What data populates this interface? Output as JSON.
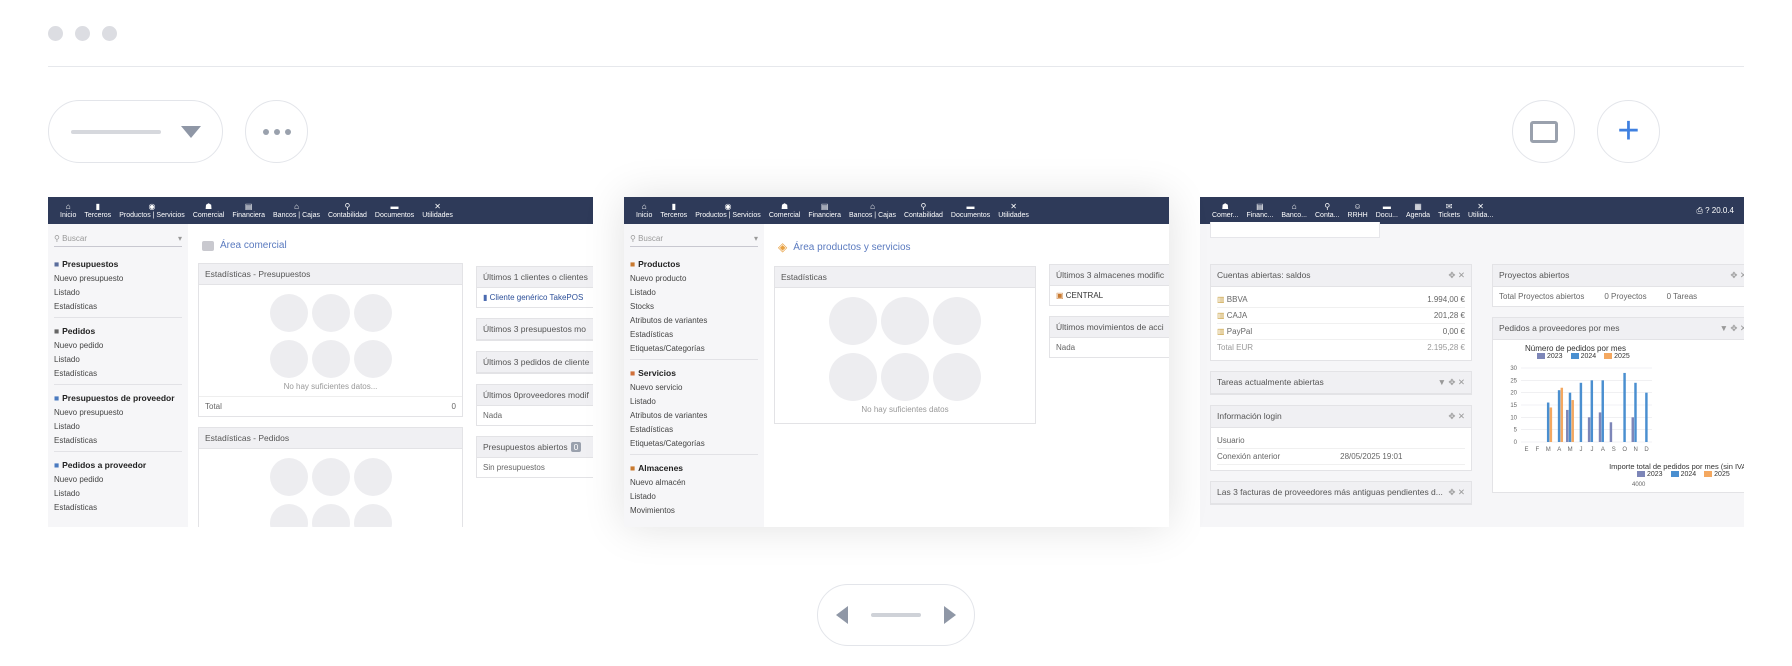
{
  "slide1": {
    "nav": [
      {
        "icon": "⌂",
        "label": "Inicio"
      },
      {
        "icon": "▮",
        "label": "Terceros"
      },
      {
        "icon": "◉",
        "label": "Productos | Servicios"
      },
      {
        "icon": "☗",
        "label": "Comercial"
      },
      {
        "icon": "▤",
        "label": "Financiera"
      },
      {
        "icon": "⌂",
        "label": "Bancos | Cajas"
      },
      {
        "icon": "⚲",
        "label": "Contabilidad"
      },
      {
        "icon": "▬",
        "label": "Documentos"
      },
      {
        "icon": "✕",
        "label": "Utilidades"
      }
    ],
    "search": "Buscar",
    "menu": [
      {
        "title": "Presupuestos",
        "items": [
          "Nuevo presupuesto",
          "Listado",
          "Estadísticas"
        ]
      },
      {
        "title": "Pedidos",
        "items": [
          "Nuevo pedido",
          "Listado",
          "Estadísticas"
        ]
      },
      {
        "title": "Presupuestos de proveedor",
        "items": [
          "Nuevo presupuesto",
          "Listado",
          "Estadísticas"
        ]
      },
      {
        "title": "Pedidos a proveedor",
        "items": [
          "Nuevo pedido",
          "Listado",
          "Estadísticas"
        ]
      }
    ],
    "area_title": "Área comercial",
    "box1_title": "Estadísticas - Presupuestos",
    "no_data": "No hay suficientes datos...",
    "total_label": "Total",
    "total_value": "0",
    "box2_title": "Estadísticas - Pedidos",
    "right_boxes": [
      {
        "title": "Últimos 1 clientes o clientes",
        "body": "Cliente genérico TakePOS"
      },
      {
        "title": "Últimos 3 presupuestos mo",
        "body": ""
      },
      {
        "title": "Últimos 3 pedidos de cliente",
        "body": ""
      },
      {
        "title": "Últimos 0proveedores modif",
        "body": "Nada"
      },
      {
        "title": "Presupuestos abiertos",
        "badge": "0",
        "body": "Sin presupuestos"
      }
    ]
  },
  "slide2": {
    "nav": [
      {
        "icon": "⌂",
        "label": "Inicio"
      },
      {
        "icon": "▮",
        "label": "Terceros"
      },
      {
        "icon": "◉",
        "label": "Productos | Servicios"
      },
      {
        "icon": "☗",
        "label": "Comercial"
      },
      {
        "icon": "▤",
        "label": "Financiera"
      },
      {
        "icon": "⌂",
        "label": "Bancos | Cajas"
      },
      {
        "icon": "⚲",
        "label": "Contabilidad"
      },
      {
        "icon": "▬",
        "label": "Documentos"
      },
      {
        "icon": "✕",
        "label": "Utilidades"
      }
    ],
    "search": "Buscar",
    "menu": [
      {
        "title": "Productos",
        "items": [
          "Nuevo producto",
          "Listado",
          "Stocks",
          "Atributos de variantes",
          "Estadísticas",
          "Etiquetas/Categorías"
        ]
      },
      {
        "title": "Servicios",
        "items": [
          "Nuevo servicio",
          "Listado",
          "Atributos de variantes",
          "Estadísticas",
          "Etiquetas/Categorías"
        ]
      },
      {
        "title": "Almacenes",
        "items": [
          "Nuevo almacén",
          "Listado",
          "Movimientos"
        ]
      }
    ],
    "area_title": "Área productos y servicios",
    "stats_title": "Estadísticas",
    "no_data": "No hay suficientes datos",
    "box_a_title": "Últimos 3 almacenes modific",
    "box_a_body": "CENTRAL",
    "box_b_title": "Últimos movimientos de acci",
    "box_b_body": "Nada"
  },
  "slide3": {
    "nav": [
      {
        "icon": "☗",
        "label": "Comer..."
      },
      {
        "icon": "▤",
        "label": "Financ..."
      },
      {
        "icon": "⌂",
        "label": "Banco..."
      },
      {
        "icon": "⚲",
        "label": "Conta..."
      },
      {
        "icon": "☺",
        "label": "RRHH"
      },
      {
        "icon": "▬",
        "label": "Docu..."
      },
      {
        "icon": "▦",
        "label": "Agenda"
      },
      {
        "icon": "✉",
        "label": "Tickets"
      },
      {
        "icon": "✕",
        "label": "Utilida..."
      }
    ],
    "version": "20.0.4",
    "accounts": {
      "title": "Cuentas abiertas: saldos",
      "rows": [
        {
          "name": "BBVA",
          "value": "1.994,00 €"
        },
        {
          "name": "CAJA",
          "value": "201,28 €"
        },
        {
          "name": "PayPal",
          "value": "0,00 €"
        }
      ],
      "total_label": "Total EUR",
      "total_value": "2.195,28 €"
    },
    "tasks_title": "Tareas actualmente abiertas",
    "login": {
      "title": "Información login",
      "user_label": "Usuario",
      "prev_label": "Conexión anterior",
      "prev_value": "28/05/2025 19:01"
    },
    "invoices_title": "Las 3 facturas de proveedores más antiguas pendientes d...",
    "projects": {
      "title": "Proyectos abiertos",
      "label": "Total Proyectos abiertos",
      "count": "0 Proyectos",
      "tasks": "0 Tareas"
    },
    "orders_title": "Pedidos a proveedores por mes",
    "chart2_title": "Importe total de pedidos por mes (sin IVA)",
    "chart2_ytick": "4000"
  },
  "chart_data": {
    "type": "bar",
    "title": "Número de pedidos por mes",
    "categories": [
      "E",
      "F",
      "M",
      "A",
      "M",
      "J",
      "J",
      "A",
      "S",
      "O",
      "N",
      "D"
    ],
    "series": [
      {
        "name": "2023",
        "color": "#7d86b8",
        "values": [
          0,
          0,
          0,
          0,
          13,
          0,
          10,
          12,
          8,
          0,
          10,
          0
        ]
      },
      {
        "name": "2024",
        "color": "#4a8fd0",
        "values": [
          0,
          0,
          16,
          21,
          20,
          24,
          25,
          25,
          0,
          28,
          24,
          20
        ]
      },
      {
        "name": "2025",
        "color": "#f4a860",
        "values": [
          0,
          0,
          14,
          22,
          17,
          0,
          0,
          0,
          0,
          0,
          0,
          0
        ]
      }
    ],
    "ylim": [
      0,
      30
    ],
    "yticks": [
      0,
      5,
      10,
      15,
      20,
      25,
      30
    ]
  }
}
